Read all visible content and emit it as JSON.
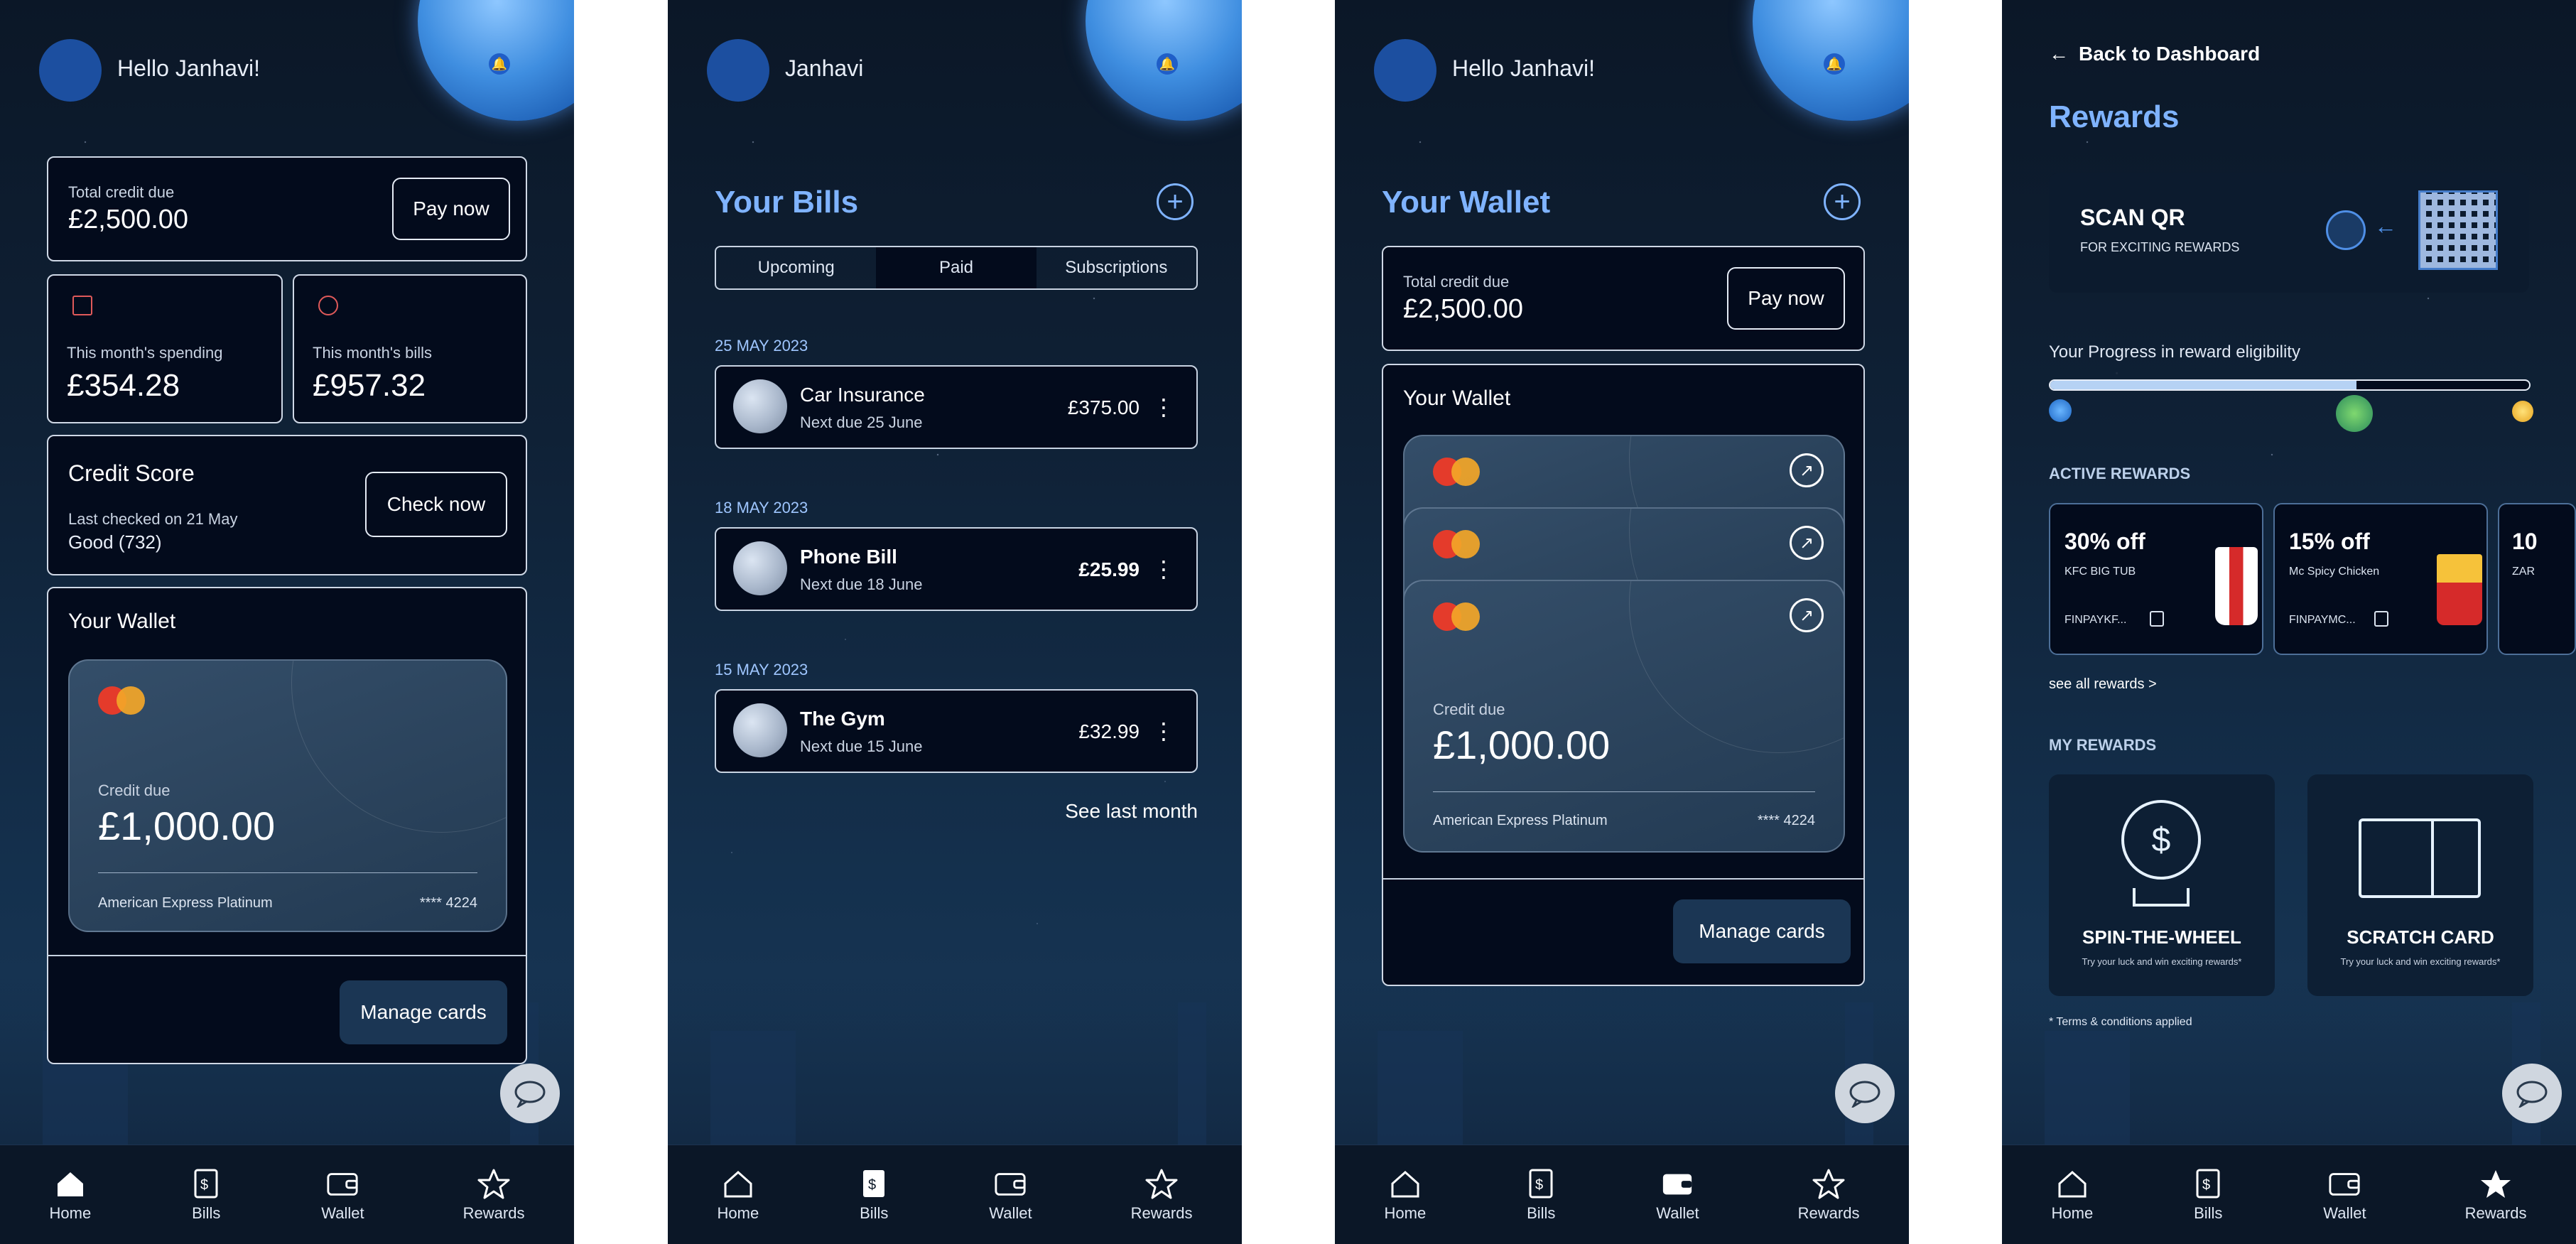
{
  "nav": {
    "home": "Home",
    "bills": "Bills",
    "wallet": "Wallet",
    "rewards": "Rewards"
  },
  "screen1": {
    "greeting": "Hello Janhavi!",
    "total_label": "Total credit due",
    "total_value": "£2,500.00",
    "pay_now": "Pay now",
    "spending_label": "This month's spending",
    "spending_value": "£354.28",
    "bills_label": "This month's bills",
    "bills_value": "£957.32",
    "credit_title": "Credit Score",
    "credit_checked": "Last checked on 21 May",
    "credit_value": "Good (732)",
    "check_now": "Check now",
    "wallet_title": "Your Wallet",
    "card": {
      "label": "Credit due",
      "value": "£1,000.00",
      "name": "American Express Platinum",
      "number": "**** 4224"
    },
    "manage": "Manage cards"
  },
  "screen2": {
    "greeting": "Janhavi",
    "title": "Your Bills",
    "tabs": [
      "Upcoming",
      "Paid",
      "Subscriptions"
    ],
    "bills": [
      {
        "date": "25 MAY 2023",
        "name": "Car Insurance",
        "due": "Next due 25 June",
        "amount": "£375.00"
      },
      {
        "date": "18 MAY 2023",
        "name": "Phone Bill",
        "due": "Next due 18 June",
        "amount": "£25.99"
      },
      {
        "date": "15 MAY 2023",
        "name": "The Gym",
        "due": "Next due 15 June",
        "amount": "£32.99"
      }
    ],
    "see_last": "See last month"
  },
  "screen3": {
    "greeting": "Hello Janhavi!",
    "title": "Your Wallet",
    "total_label": "Total credit due",
    "total_value": "£2,500.00",
    "pay_now": "Pay now",
    "wallet_title": "Your Wallet",
    "card": {
      "label": "Credit due",
      "value": "£1,000.00",
      "name": "American Express Platinum",
      "number": "**** 4224"
    },
    "manage": "Manage cards"
  },
  "screen4": {
    "back": "Back to Dashboard",
    "title": "Rewards",
    "scan_title": "SCAN QR",
    "scan_sub": "FOR EXCITING REWARDS",
    "progress_label": "Your Progress in reward eligibility",
    "progress_fraction": 0.64,
    "active_title": "ACTIVE REWARDS",
    "offers": [
      {
        "title": "30% off",
        "desc": "KFC BIG TUB",
        "code": "FINPAYKF..."
      },
      {
        "title": "15% off",
        "desc": "Mc Spicy Chicken",
        "code": "FINPAYMC..."
      },
      {
        "title": "10",
        "desc": "ZAR",
        "code": ""
      }
    ],
    "see_all": "see  all rewards >",
    "my_title": "MY REWARDS",
    "spin_title": "SPIN-THE-WHEEL",
    "spin_sub": "Try your luck and win exciting rewards*",
    "scratch_title": "SCRATCH CARD",
    "scratch_sub": "Try your luck and win exciting rewards*",
    "terms": "* Terms & conditions applied"
  }
}
